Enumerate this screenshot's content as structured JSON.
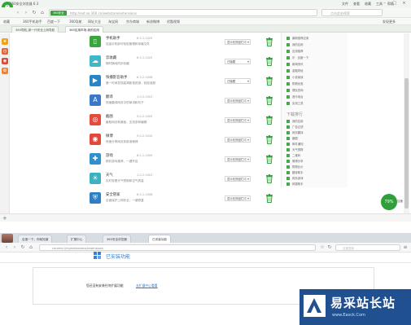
{
  "top_window": {
    "title": "360安全浏览器 6.3",
    "menu": [
      "文件",
      "查看",
      "收藏",
      "工具",
      "帮助"
    ],
    "address_badge": "360安全",
    "url": "http://ext.se.360.cn/webstore/extensions",
    "search_placeholder": "点击此处搜索",
    "bookmarks": [
      "收藏",
      "360手机助手",
      "百度一下",
      "360导航",
      "网址大全",
      "淘宝网",
      "京东商城",
      "新浪微博",
      "优酷视频",
      "发现更多"
    ],
    "tabs": [
      "360导航_新一代安全上网导航",
      "360应用市场-我的应用"
    ],
    "extensions": [
      {
        "name": "手机助手",
        "version": "6.3.1.1025",
        "desc": "连接手机即可轻松管理和传输文件",
        "action": "显示在按钮栏中",
        "color": "#3aa43e",
        "icon": "phone-icon"
      },
      {
        "name": "云收藏",
        "version": "6.3.1.1022",
        "desc": "随时随地同步收藏",
        "action": "已隐藏",
        "color": "#3fb6c9",
        "icon": "cloud-icon"
      },
      {
        "name": "快播影音助手",
        "version": "6.3.2.1008",
        "desc": "第一时间发现高清影视资源，轻松追剧",
        "action": "已隐藏",
        "color": "#2785c9",
        "icon": "video-icon"
      },
      {
        "name": "翻译",
        "version": "1.0.5.1001",
        "desc": "快速翻译网页中的单词和句子",
        "action": "显示在按钮栏中",
        "color": "#3a76c9",
        "icon": "translate-icon"
      },
      {
        "name": "截图",
        "version": "5.0.2.1005",
        "desc": "截取网页和桌面，支持多种编辑",
        "action": "显示在按钮栏中",
        "color": "#e54b3c",
        "icon": "screenshot-icon"
      },
      {
        "name": "微博",
        "version": "5.0.2.1010",
        "desc": "快速分享网页到新浪微博",
        "action": "显示在按钮栏中",
        "color": "#e2483a",
        "icon": "weibo-icon"
      },
      {
        "name": "游戏",
        "version": "6.2.1.1009",
        "desc": "精彩游戏推荐，一键开启",
        "action": "显示在按钮栏中",
        "color": "#2f8fcf",
        "icon": "game-icon"
      },
      {
        "name": "天气",
        "version": "1.0.2.1001",
        "desc": "实时查看天气预报和空气质量",
        "action": "显示在按钮栏中",
        "color": "#3bb2c3",
        "icon": "weather-icon"
      },
      {
        "name": "安全管家",
        "version": "6.3.1.1008",
        "desc": "全面保护上网安全，一键修复",
        "action": "显示在按钮栏中",
        "color": "#2e7fc4",
        "icon": "shield-icon"
      }
    ],
    "right_panel": {
      "items_top": [
        "最新推荐应用",
        "我的应用",
        "应用推荐",
        "乐 · 百度一下",
        "新闻资讯",
        "金融财经",
        "小说阅读",
        "购物优惠",
        "便民查询",
        "音乐电台",
        "实用工具"
      ],
      "header": "下载排行",
      "items_bottom": [
        "我的应用",
        "广告过滤",
        "网页翻译",
        "截图",
        "邮件通知",
        "天气预报",
        "二维码",
        "微博分享",
        "购物比价",
        "翻译助手",
        "网页游戏",
        "网银助手"
      ]
    },
    "badge": "79%",
    "badge_label": "加速"
  },
  "bottom_window": {
    "tabs": [
      "百度一下，你就知道",
      "扩展中心",
      "360安全浏览器",
      "已安装功能"
    ],
    "url": "chrome://myextensions/extensions",
    "search_placeholder": "百度搜索",
    "heading": "已安装功能",
    "empty_text": "您还没有安装任何扩展功能",
    "empty_link": "去扩展中心看看"
  },
  "watermark": {
    "title": "易采站长站",
    "subtitle": "www.Easck.Com"
  }
}
